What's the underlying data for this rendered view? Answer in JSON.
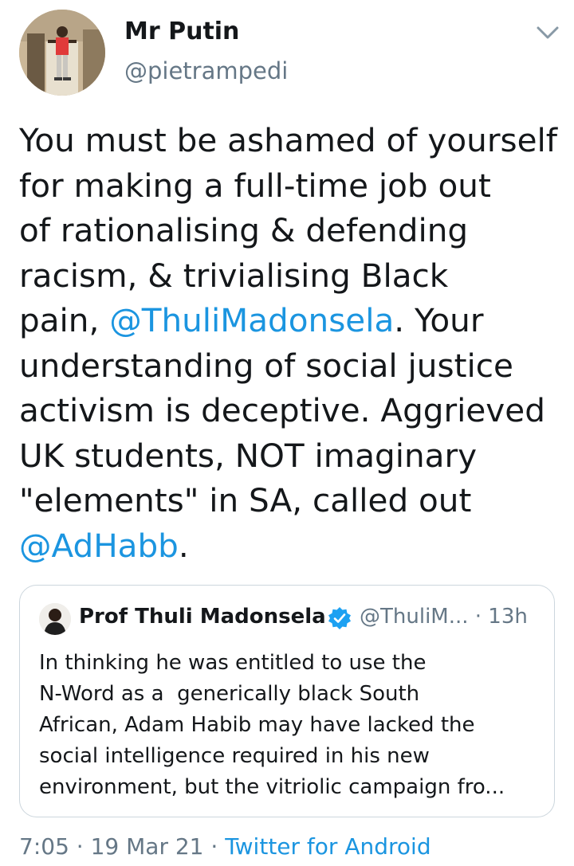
{
  "author": {
    "name": "Mr Putin",
    "handle": "@pietrampedi"
  },
  "tweet": {
    "lines": [
      {
        "parts": [
          {
            "text": "You must be ashamed of yourself"
          }
        ]
      },
      {
        "parts": [
          {
            "text": "for making a full-time job out"
          }
        ]
      },
      {
        "parts": [
          {
            "text": "of rationalising & defending"
          }
        ]
      },
      {
        "parts": [
          {
            "text": "racism, & trivialising Black"
          }
        ]
      },
      {
        "parts": [
          {
            "text": "pain, "
          },
          {
            "text": "@ThuliMadonsela",
            "mention": true
          },
          {
            "text": ". Your"
          }
        ]
      },
      {
        "parts": [
          {
            "text": "understanding of social justice"
          }
        ]
      },
      {
        "parts": [
          {
            "text": "activism is deceptive. Aggrieved"
          }
        ]
      },
      {
        "parts": [
          {
            "text": "UK students, NOT imaginary"
          }
        ]
      },
      {
        "parts": [
          {
            "text": "\"elements\" in SA, called out"
          }
        ]
      },
      {
        "parts": [
          {
            "text": "@AdHabb",
            "mention": true
          },
          {
            "text": "."
          }
        ]
      }
    ]
  },
  "quoted": {
    "name": "Prof Thuli Madonsela",
    "meta": "@ThuliM... · 13h",
    "lines": [
      "In thinking he was entitled to use the",
      "N-Word as a  generically black South",
      "African, Adam Habib may have lacked the",
      "social intelligence required in his new",
      "environment, but the vitriolic campaign fro..."
    ]
  },
  "footer": {
    "time": "7:05",
    "separator": " · ",
    "date": "19 Mar 21",
    "source": "Twitter for Android"
  },
  "colors": {
    "link": "#1b95e0",
    "secondary": "#657786",
    "text": "#14171a",
    "border": "#ccd6dd"
  },
  "icons": {
    "caret": "chevron-down-icon",
    "verified": "verified-badge-icon"
  }
}
